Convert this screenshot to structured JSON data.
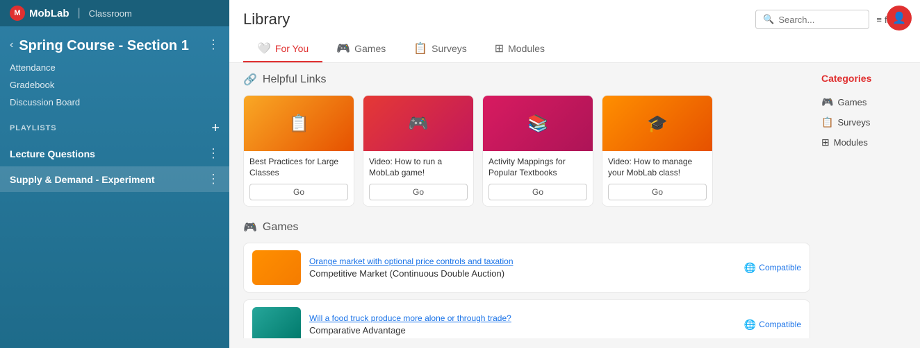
{
  "sidebar": {
    "logo_text": "MobLab",
    "classroom_label": "Classroom",
    "section_title": "Spring Course - Section 1",
    "nav_links": [
      {
        "id": "attendance",
        "label": "Attendance"
      },
      {
        "id": "gradebook",
        "label": "Gradebook"
      },
      {
        "id": "discussion",
        "label": "Discussion Board"
      }
    ],
    "playlists_label": "PLAYLISTS",
    "add_label": "+",
    "playlists": [
      {
        "id": "lecture",
        "label": "Lecture Questions",
        "active": false
      },
      {
        "id": "supply-demand",
        "label": "Supply & Demand - Experiment",
        "active": true
      }
    ]
  },
  "header": {
    "library_title": "Library",
    "search_placeholder": "Search...",
    "filters_label": "filters"
  },
  "tabs": [
    {
      "id": "for-you",
      "label": "For You",
      "active": true
    },
    {
      "id": "games",
      "label": "Games",
      "active": false
    },
    {
      "id": "surveys",
      "label": "Surveys",
      "active": false
    },
    {
      "id": "modules",
      "label": "Modules",
      "active": false
    }
  ],
  "helpful_links": {
    "section_label": "Helpful Links",
    "cards": [
      {
        "id": "best-practices",
        "title": "Best Practices for Large Classes",
        "thumb_color": "orange",
        "thumb_emoji": "📋",
        "go_label": "Go"
      },
      {
        "id": "how-to-run",
        "title": "Video: How to run a MobLab game!",
        "thumb_color": "red",
        "thumb_emoji": "🎮",
        "go_label": "Go"
      },
      {
        "id": "activity-mappings",
        "title": "Activity Mappings for Popular Textbooks",
        "thumb_color": "pink",
        "thumb_emoji": "📚",
        "go_label": "Go"
      },
      {
        "id": "manage-class",
        "title": "Video: How to manage your MobLab class!",
        "thumb_color": "amber",
        "thumb_emoji": "🎓",
        "go_label": "Go"
      }
    ]
  },
  "games": {
    "section_label": "Games",
    "items": [
      {
        "id": "competitive-market",
        "subtitle": "Orange market with optional price controls and taxation",
        "title": "Competitive Market (Continuous Double Auction)",
        "thumb_color": "market",
        "badge": "Compatible"
      },
      {
        "id": "comparative-advantage",
        "subtitle": "Will a food truck produce more alone or through trade?",
        "title": "Comparative Advantage",
        "thumb_color": "truck",
        "badge": "Compatible"
      }
    ]
  },
  "categories": {
    "title": "Categories",
    "items": [
      {
        "id": "games-cat",
        "label": "Games"
      },
      {
        "id": "surveys-cat",
        "label": "Surveys"
      },
      {
        "id": "modules-cat",
        "label": "Modules"
      }
    ]
  },
  "avatar": {
    "icon": "👤"
  }
}
